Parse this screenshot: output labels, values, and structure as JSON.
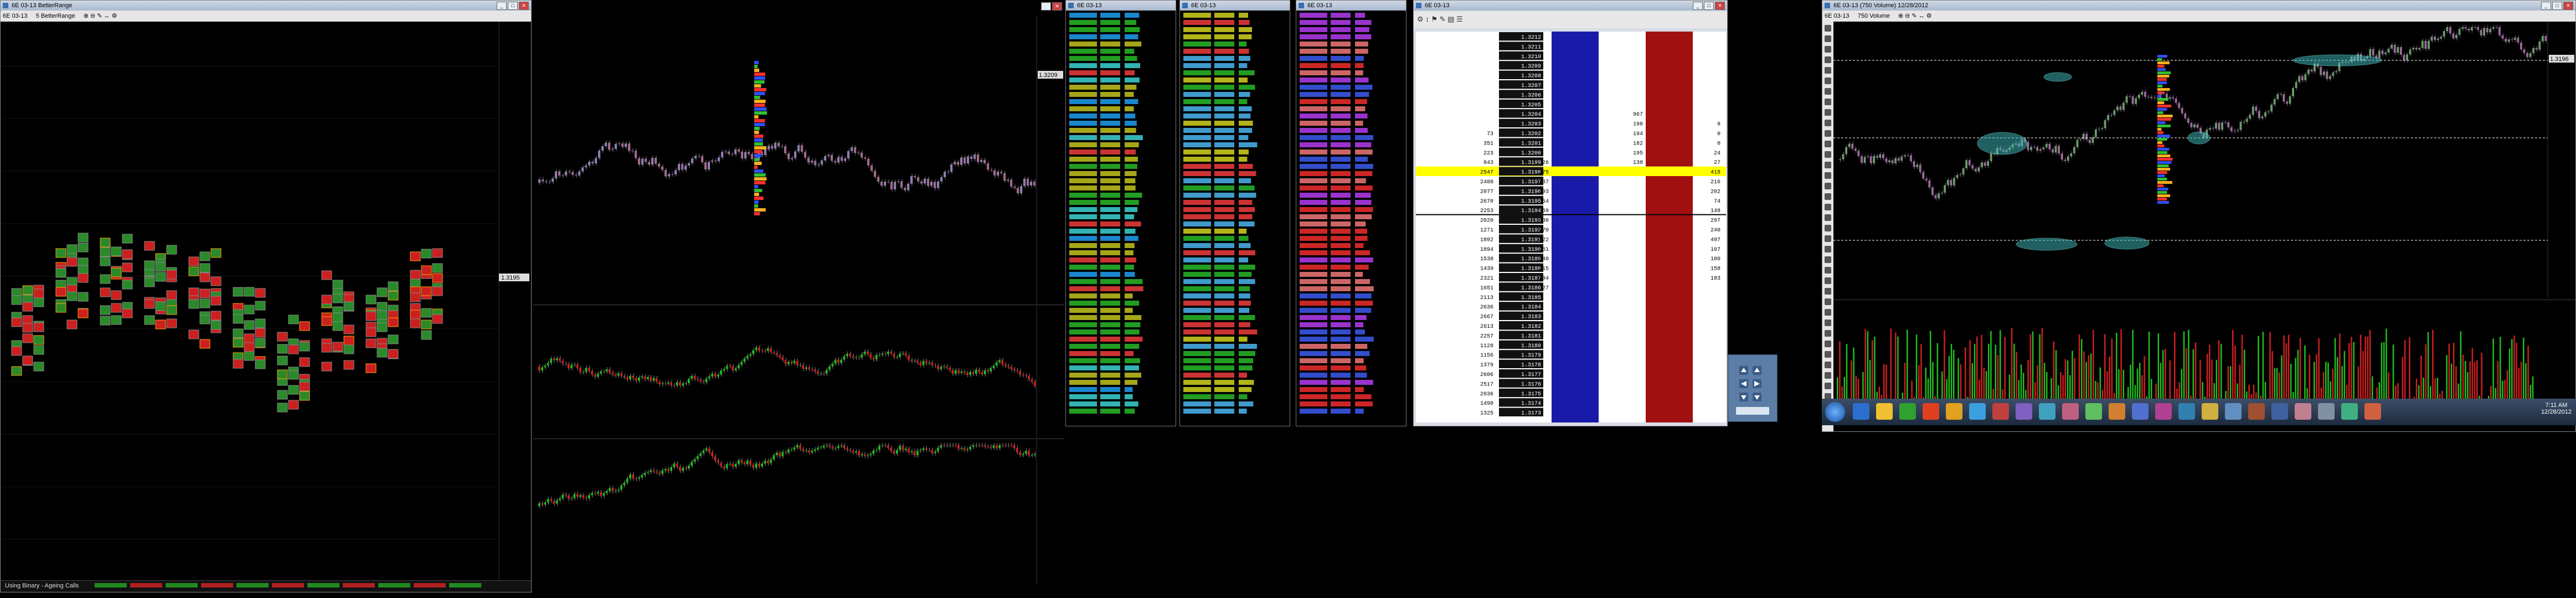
{
  "win1": {
    "title": "6E 03-13 BetterRange",
    "instrument": "6E 03-13",
    "chart_type": "5 BetterRange",
    "footer": "Using Binary - Ageing Calls",
    "price_tag": "1.3195"
  },
  "win2": {
    "price_tag": "1.3209"
  },
  "tape1": {
    "title": "6E 03-13"
  },
  "tape2": {
    "title": "6E 03-13"
  },
  "tape3": {
    "title": "6E 03-13"
  },
  "dom": {
    "title": "6E 03-13",
    "rows": [
      {
        "left": "",
        "price": "1.3212",
        "bid": "",
        "ask": "",
        "right": ""
      },
      {
        "left": "",
        "price": "1.3211",
        "bid": "",
        "ask": "",
        "right": ""
      },
      {
        "left": "",
        "price": "1.3210",
        "bid": "",
        "ask": "",
        "right": ""
      },
      {
        "left": "",
        "price": "1.3209",
        "bid": "",
        "ask": "",
        "right": ""
      },
      {
        "left": "",
        "price": "1.3208",
        "bid": "",
        "ask": "",
        "right": ""
      },
      {
        "left": "",
        "price": "1.3207",
        "bid": "",
        "ask": "",
        "right": ""
      },
      {
        "left": "",
        "price": "1.3206",
        "bid": "",
        "ask": "",
        "right": ""
      },
      {
        "left": "",
        "price": "1.3205",
        "bid": "",
        "ask": "",
        "right": ""
      },
      {
        "left": "",
        "price": "1.3204",
        "bid": "",
        "ask": "967",
        "right": ""
      },
      {
        "left": "",
        "price": "1.3203",
        "bid": "",
        "ask": "198",
        "right": "9"
      },
      {
        "left": "73",
        "price": "1.3202",
        "bid": "",
        "ask": "194",
        "right": "0"
      },
      {
        "left": "351",
        "price": "1.3201",
        "bid": "",
        "ask": "182",
        "right": "0"
      },
      {
        "left": "223",
        "price": "1.3200",
        "bid": "",
        "ask": "195",
        "right": "24"
      },
      {
        "left": "843",
        "price": "1.3199",
        "bid": "26",
        "ask": "138",
        "right": "27"
      },
      {
        "left": "2547",
        "price": "1.3198",
        "bid": "175",
        "ask": "",
        "right": "415"
      },
      {
        "left": "2488",
        "price": "1.3197",
        "bid": "137",
        "ask": "",
        "right": "216"
      },
      {
        "left": "2077",
        "price": "1.3196",
        "bid": "193",
        "ask": "",
        "right": "202"
      },
      {
        "left": "2670",
        "price": "1.3195",
        "bid": "54",
        "ask": "",
        "right": "74"
      },
      {
        "left": "2253",
        "price": "1.3194",
        "bid": "59",
        "ask": "",
        "right": "148"
      },
      {
        "left": "2020",
        "price": "1.3193",
        "bid": "330",
        "ask": "",
        "right": "297"
      },
      {
        "left": "1271",
        "price": "1.3192",
        "bid": "270",
        "ask": "",
        "right": "240"
      },
      {
        "left": "1892",
        "price": "1.3191",
        "bid": "322",
        "ask": "",
        "right": "497"
      },
      {
        "left": "1894",
        "price": "1.3190",
        "bid": "261",
        "ask": "",
        "right": "107"
      },
      {
        "left": "1538",
        "price": "1.3189",
        "bid": "140",
        "ask": "",
        "right": "180"
      },
      {
        "left": "1439",
        "price": "1.3188",
        "bid": "215",
        "ask": "",
        "right": "158"
      },
      {
        "left": "2321",
        "price": "1.3187",
        "bid": "204",
        "ask": "",
        "right": "183"
      },
      {
        "left": "1651",
        "price": "1.3186",
        "bid": "27",
        "ask": "",
        "right": ""
      },
      {
        "left": "2113",
        "price": "1.3185",
        "bid": "",
        "ask": "",
        "right": ""
      },
      {
        "left": "2636",
        "price": "1.3184",
        "bid": "",
        "ask": "",
        "right": ""
      },
      {
        "left": "2667",
        "price": "1.3183",
        "bid": "",
        "ask": "",
        "right": ""
      },
      {
        "left": "2613",
        "price": "1.3182",
        "bid": "",
        "ask": "",
        "right": ""
      },
      {
        "left": "2257",
        "price": "1.3181",
        "bid": "",
        "ask": "",
        "right": ""
      },
      {
        "left": "1128",
        "price": "1.3180",
        "bid": "",
        "ask": "",
        "right": ""
      },
      {
        "left": "1156",
        "price": "1.3179",
        "bid": "",
        "ask": "",
        "right": ""
      },
      {
        "left": "1379",
        "price": "1.3178",
        "bid": "",
        "ask": "",
        "right": ""
      },
      {
        "left": "2606",
        "price": "1.3177",
        "bid": "",
        "ask": "",
        "right": ""
      },
      {
        "left": "2517",
        "price": "1.3176",
        "bid": "",
        "ask": "",
        "right": ""
      },
      {
        "left": "2036",
        "price": "1.3175",
        "bid": "",
        "ask": "",
        "right": ""
      },
      {
        "left": "1498",
        "price": "1.3174",
        "bid": "",
        "ask": "",
        "right": ""
      },
      {
        "left": "1325",
        "price": "1.3173",
        "bid": "",
        "ask": "",
        "right": ""
      }
    ]
  },
  "win_right": {
    "title": "6E 03-13 (750 Volume) 12/28/2012",
    "instrument": "6E 03-13",
    "chart_type": "750 Volume",
    "price_tag": "1.3196"
  },
  "clock": {
    "time": "7:11 AM",
    "date": "12/28/2012"
  },
  "colors": {
    "up": "#2ecc40",
    "down": "#e02020",
    "dom_blue": "#1a1aa8",
    "dom_red": "#a01010",
    "highlight": "#ffff00"
  }
}
